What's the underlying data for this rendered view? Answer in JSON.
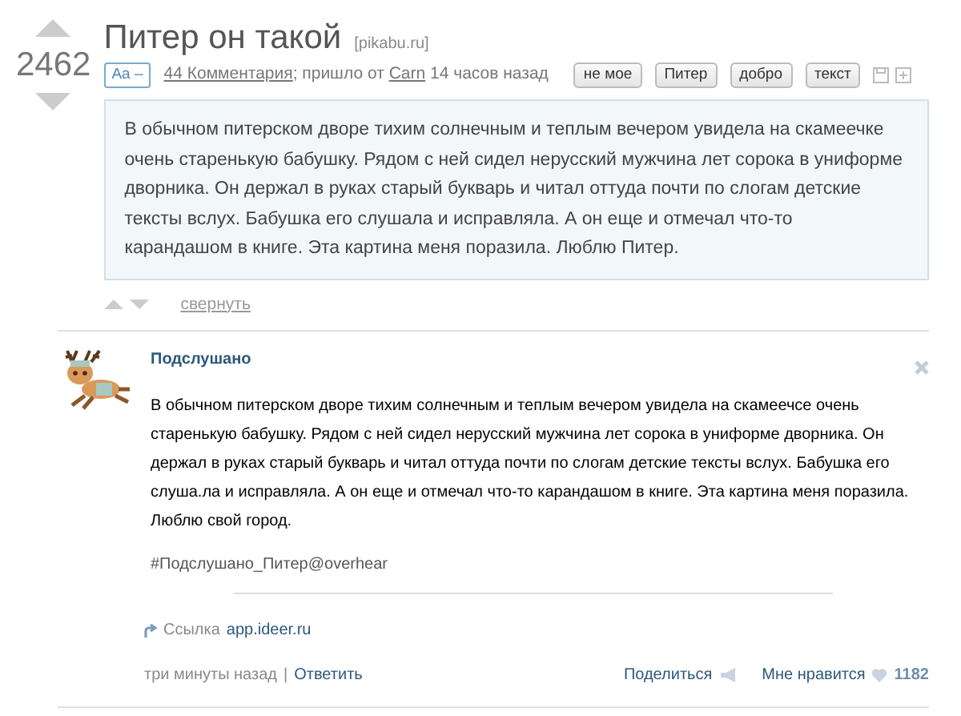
{
  "post": {
    "rating": "2462",
    "title": "Питер он такой",
    "source": "[pikabu.ru]",
    "font_toggle": "Aa –",
    "meta": {
      "comments": "44 Комментария",
      "middle": "; пришло от",
      "author": "Carn",
      "time": "14 часов назад"
    },
    "tags": [
      "не мое",
      "Питер",
      "добро",
      "текст"
    ],
    "body": "В обычном питерском дворе тихим солнечным и теплым вечером увидела на скамеечке очень старенькую бабушку. Рядом с ней сидел нерусский мужчина лет сорока в униформе дворника. Он держал в руках старый букварь и читал оттуда почти по слогам детские тексты вслух. Бабушка его слушала и исправляла. А он еще и отмечал что-то карандашом в книге. Эта картина меня поразила. Люблю Питер.",
    "collapse": "свернуть"
  },
  "embed": {
    "author": "Подслушано",
    "text": "В обычном питерском дворе тихим солнечным и теплым вечером увидела на скамеечсе очень старенькую бабушку. Рядом с ней сидел нерусский мужчина лет сорока в униформе дворника. Он держал в руках старый букварь и читал оттуда почти по слогам детские тексты вслух. Бабушка его слуша.ла и исправляла. А он еще и отмечал что-то карандашом в книге. Эта картина меня поразила. Люблю свой город.",
    "hashtag": "#Подслушано_Питер@overhear",
    "link_label": "Ссылка",
    "link": "app.ideer.ru",
    "time": "три минуты назад",
    "separator": "|",
    "reply": "Ответить",
    "share": "Поделиться",
    "like": "Мне нравится",
    "like_count": "1182"
  }
}
